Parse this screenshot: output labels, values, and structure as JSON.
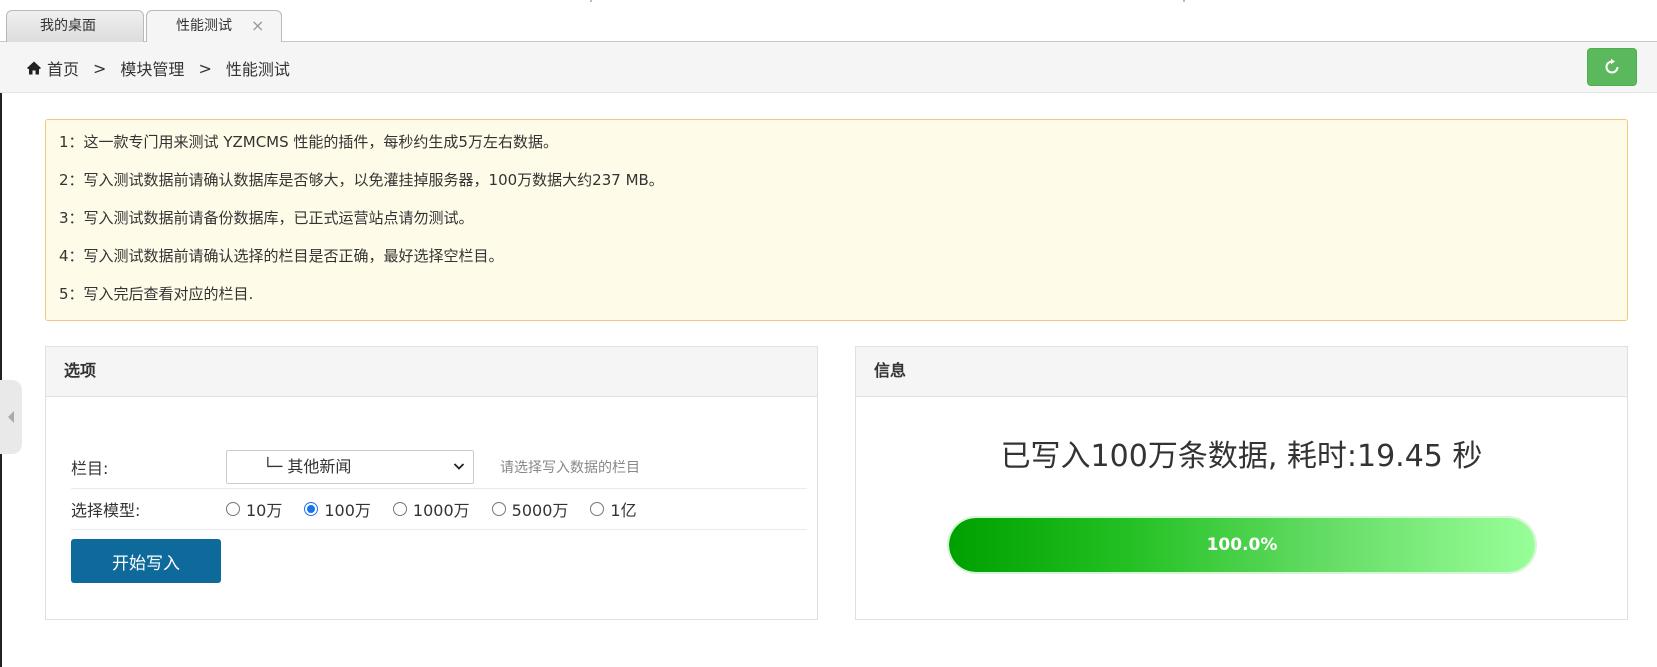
{
  "tabs": [
    {
      "label": "我的桌面",
      "active": false
    },
    {
      "label": "性能测试",
      "active": true,
      "close": "×"
    }
  ],
  "breadcrumb": {
    "home": "首页",
    "separator": ">",
    "items": [
      "模块管理",
      "性能测试"
    ]
  },
  "notice": {
    "lines": [
      "1：这一款专门用来测试 YZMCMS 性能的插件，每秒约生成5万左右数据。",
      "2：写入测试数据前请确认数据库是否够大，以免灌挂掉服务器，100万数据大约237 MB。",
      "3：写入测试数据前请备份数据库，已正式运营站点请勿测试。",
      "4：写入测试数据前请确认选择的栏目是否正确，最好选择空栏目。",
      "5：写入完后查看对应的栏目."
    ]
  },
  "options_panel": {
    "title": "选项",
    "category_label": "栏目:",
    "category_value": "└─ 其他新闻",
    "category_hint": "请选择写入数据的栏目",
    "model_label": "选择模型:",
    "models": [
      {
        "label": "10万",
        "checked": false
      },
      {
        "label": "100万",
        "checked": true
      },
      {
        "label": "1000万",
        "checked": false
      },
      {
        "label": "5000万",
        "checked": false
      },
      {
        "label": "1亿",
        "checked": false
      }
    ],
    "start_button": "开始写入"
  },
  "info_panel": {
    "title": "信息",
    "message": "已写入100万条数据, 耗时:19.45 秒",
    "progress_percent": 100,
    "progress_label": "100.0%"
  },
  "colors": {
    "primary_button": "#0f6a9c",
    "refresh_button": "#5cb85c",
    "notice_bg": "#fffbe9",
    "notice_border": "#f4c77e",
    "progress_start": "#00a000",
    "progress_end": "#99ff99"
  },
  "icons": {
    "home": "home-icon",
    "refresh": "refresh-icon",
    "side_toggle": "caret-left-icon",
    "select_chevron": "chevron-down-icon"
  }
}
